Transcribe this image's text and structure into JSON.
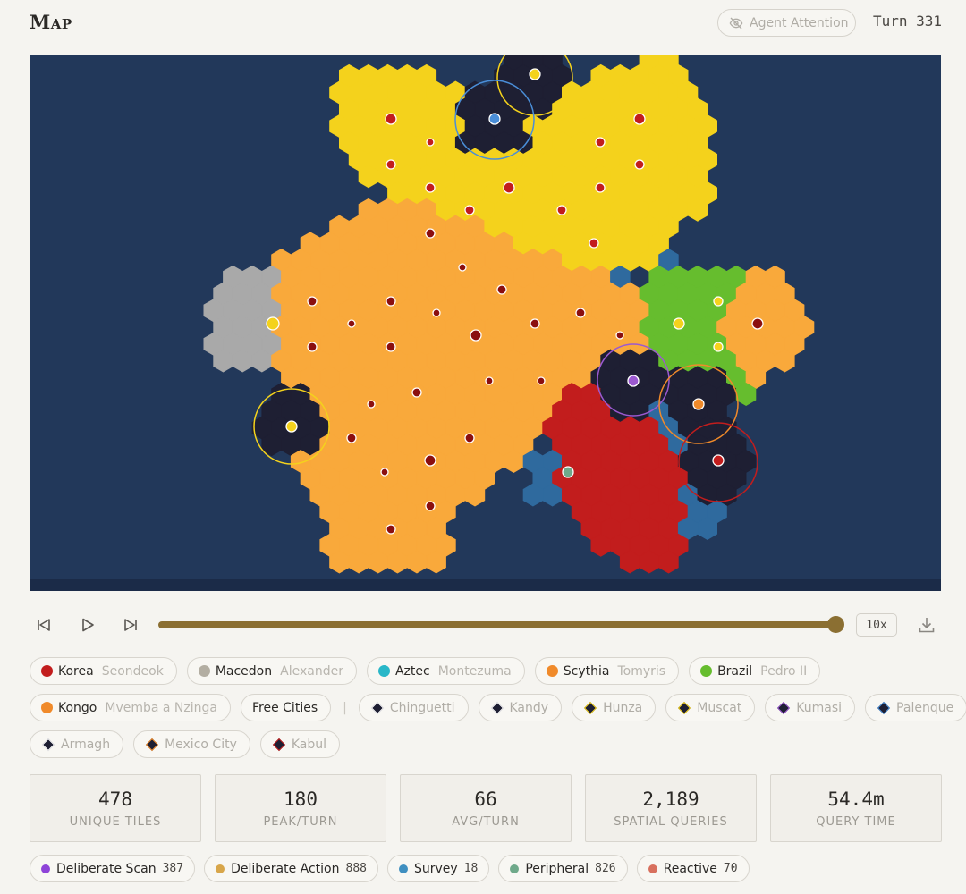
{
  "header": {
    "title": "Map",
    "attention_label": "Agent Attention",
    "turn_label": "Turn 331"
  },
  "player": {
    "speed": "10x",
    "progress": 1.0
  },
  "map": {
    "colors": {
      "ocean": "#22385a",
      "shallow": "#2f6a9e",
      "korea": "#c21d1d",
      "macedon": "#a9a9a9",
      "aztec": "#f4d21c",
      "scythia": "#f9a93b",
      "brazil": "#66bd2e",
      "kongo": "#f9a93b",
      "city_state": "#1e1f33"
    }
  },
  "civs": [
    {
      "name": "Korea",
      "leader": "Seondeok",
      "color": "#c21d1d",
      "icon": "korea-icon"
    },
    {
      "name": "Macedon",
      "leader": "Alexander",
      "color": "#a9a9a9",
      "icon": "macedon-icon"
    },
    {
      "name": "Aztec",
      "leader": "Montezuma",
      "color": "#29b7c8",
      "icon": "aztec-icon"
    },
    {
      "name": "Scythia",
      "leader": "Tomyris",
      "color": "#f08a2a",
      "icon": "scythia-icon"
    },
    {
      "name": "Brazil",
      "leader": "Pedro II",
      "color": "#66bd2e",
      "icon": "brazil-icon"
    },
    {
      "name": "Kongo",
      "leader": "Mvemba a Nzinga",
      "color": "#f08a2a",
      "icon": "kongo-icon"
    }
  ],
  "free_cities_label": "Free Cities",
  "city_states": [
    {
      "name": "Chinguetti",
      "color": "#ffffff"
    },
    {
      "name": "Kandy",
      "color": "#ffffff"
    },
    {
      "name": "Hunza",
      "color": "#f4d21c"
    },
    {
      "name": "Muscat",
      "color": "#f4d21c"
    },
    {
      "name": "Kumasi",
      "color": "#9b59d0"
    },
    {
      "name": "Palenque",
      "color": "#4a8ed8"
    },
    {
      "name": "Armagh",
      "color": "#ffffff"
    },
    {
      "name": "Mexico City",
      "color": "#f08a2a"
    },
    {
      "name": "Kabul",
      "color": "#c21d1d"
    }
  ],
  "stats": [
    {
      "value": "478",
      "label": "UNIQUE TILES"
    },
    {
      "value": "180",
      "label": "PEAK/TURN"
    },
    {
      "value": "66",
      "label": "AVG/TURN"
    },
    {
      "value": "2,189",
      "label": "SPATIAL QUERIES"
    },
    {
      "value": "54.4m",
      "label": "QUERY TIME"
    }
  ],
  "legend": [
    {
      "label": "Deliberate Scan",
      "count": "387",
      "color": "#8e44d8"
    },
    {
      "label": "Deliberate Action",
      "count": "888",
      "color": "#d8a64a"
    },
    {
      "label": "Survey",
      "count": "18",
      "color": "#3f8fc0"
    },
    {
      "label": "Peripheral",
      "count": "826",
      "color": "#6fa98a"
    },
    {
      "label": "Reactive",
      "count": "70",
      "color": "#d8705e"
    }
  ]
}
